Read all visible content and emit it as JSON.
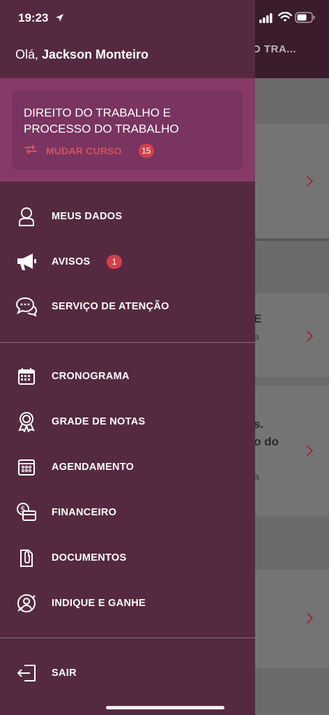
{
  "status_bar": {
    "time": "19:23"
  },
  "background": {
    "header_title": "O TRA...",
    "card_text_1": "E",
    "card_sub_1": "a",
    "card_text_2a": "s.",
    "card_text_2b": "o do",
    "card_sub_2": "a"
  },
  "drawer": {
    "greeting_prefix": "Olá, ",
    "user_name": "Jackson Monteiro",
    "course": {
      "title": "DIREITO DO TRABALHO E PROCESSO DO TRABALHO",
      "change_label": "MUDAR CURSO",
      "count": "15"
    },
    "menu_primary": [
      {
        "label": "MEUS DADOS",
        "icon": "user-icon"
      },
      {
        "label": "AVISOS",
        "icon": "megaphone-icon",
        "badge": "1"
      },
      {
        "label": "SERVIÇO DE ATENÇÃO",
        "icon": "chat-bubbles-icon"
      }
    ],
    "menu_secondary": [
      {
        "label": "CRONOGRAMA",
        "icon": "calendar-icon"
      },
      {
        "label": "GRADE DE NOTAS",
        "icon": "award-icon"
      },
      {
        "label": "AGENDAMENTO",
        "icon": "calendar-grid-icon"
      },
      {
        "label": "FINANCEIRO",
        "icon": "money-icon"
      },
      {
        "label": "DOCUMENTOS",
        "icon": "document-clip-icon"
      },
      {
        "label": "INDIQUE E GANHE",
        "icon": "referral-icon"
      }
    ],
    "logout_label": "SAIR"
  },
  "colors": {
    "drawer_bg": "#552a41",
    "course_panel_bg": "#853a67",
    "accent": "#d5515f",
    "badge_bg": "#d63e4d"
  }
}
